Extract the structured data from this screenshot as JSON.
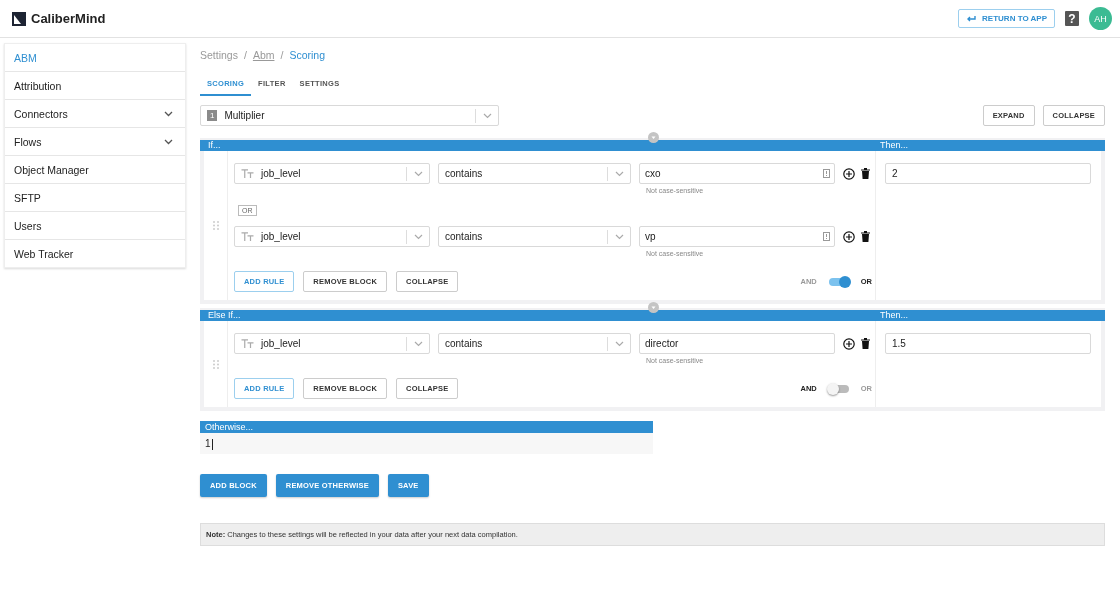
{
  "header": {
    "logo": "CaliberMind",
    "return_button": "RETURN TO APP",
    "help": "?",
    "avatar": "AH"
  },
  "sidebar": {
    "items": [
      {
        "label": "ABM",
        "selected": true,
        "expandable": false
      },
      {
        "label": "Attribution",
        "selected": false,
        "expandable": false
      },
      {
        "label": "Connectors",
        "selected": false,
        "expandable": true
      },
      {
        "label": "Flows",
        "selected": false,
        "expandable": true
      },
      {
        "label": "Object Manager",
        "selected": false,
        "expandable": false
      },
      {
        "label": "SFTP",
        "selected": false,
        "expandable": false
      },
      {
        "label": "Users",
        "selected": false,
        "expandable": false
      },
      {
        "label": "Web Tracker",
        "selected": false,
        "expandable": false
      }
    ]
  },
  "breadcrumb": {
    "separator": "/",
    "items": [
      {
        "label": "Settings",
        "kind": "plain"
      },
      {
        "label": "Abm",
        "kind": "link"
      },
      {
        "label": "Scoring",
        "kind": "current"
      }
    ]
  },
  "tabs": [
    {
      "label": "SCORING",
      "selected": true
    },
    {
      "label": "FILTER",
      "selected": false
    },
    {
      "label": "SETTINGS",
      "selected": false
    }
  ],
  "score_type": {
    "badge": "1",
    "value": "Multiplier"
  },
  "top_buttons": [
    "EXPAND",
    "COLLAPSE"
  ],
  "blocks": [
    {
      "header": "If...",
      "then_header": "Then...",
      "joiner": "OR",
      "rules": [
        {
          "field": "job_level",
          "operator": "contains",
          "value": "cxo",
          "hint": "Not case-sensitive",
          "list_icon": true
        },
        {
          "field": "job_level",
          "operator": "contains",
          "value": "vp",
          "hint": "Not case-sensitive",
          "list_icon": true
        }
      ],
      "buttons": [
        "ADD RULE",
        "REMOVE BLOCK",
        "COLLAPSE"
      ],
      "and_label": "AND",
      "or_label": "OR",
      "or_on": true,
      "then_value": "2"
    },
    {
      "header": "Else If...",
      "then_header": "Then...",
      "rules": [
        {
          "field": "job_level",
          "operator": "contains",
          "value": "director",
          "hint": "Not case-sensitive",
          "list_icon": false
        }
      ],
      "buttons": [
        "ADD RULE",
        "REMOVE BLOCK",
        "COLLAPSE"
      ],
      "and_label": "AND",
      "or_label": "OR",
      "or_on": false,
      "then_value": "1.5"
    }
  ],
  "otherwise": {
    "header": "Otherwise...",
    "value": "1"
  },
  "actions": [
    "ADD BLOCK",
    "REMOVE OTHERWISE",
    "SAVE"
  ],
  "note": "**Note:** Changes to these settings will be reflected in your data after your next data compilation."
}
